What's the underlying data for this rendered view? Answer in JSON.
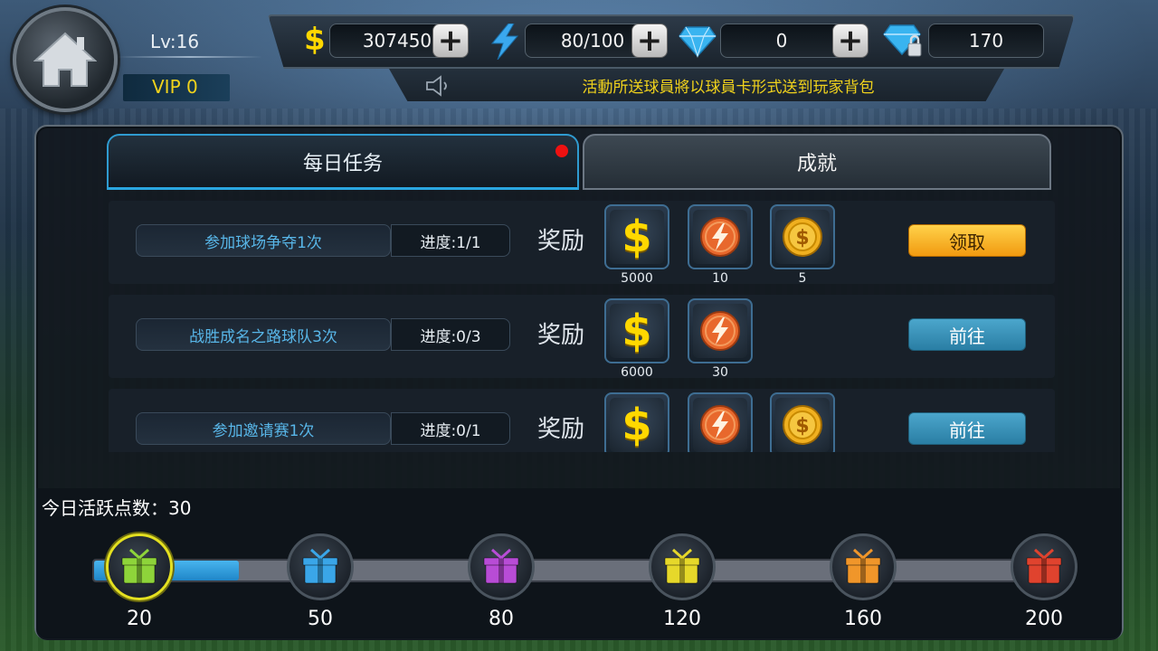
{
  "header": {
    "level": "Lv:16",
    "vip": "VIP 0"
  },
  "resources": {
    "money": {
      "icon": "dollar-icon",
      "value": "307450"
    },
    "energy": {
      "icon": "lightning-icon",
      "value": "80/100"
    },
    "diamond": {
      "icon": "diamond-icon",
      "value": "0"
    },
    "locked_diamond": {
      "icon": "locked-diamond-icon",
      "value": "170"
    }
  },
  "notice": {
    "text": "活動所送球員將以球員卡形式送到玩家背包"
  },
  "tabs": {
    "daily": "每日任务",
    "achievement": "成就"
  },
  "tasks": [
    {
      "title": "参加球场争夺1次",
      "progress": "进度:1/1",
      "reward_label": "奖励",
      "rewards": [
        {
          "type": "dollar",
          "count": "5000"
        },
        {
          "type": "energy",
          "count": "10"
        },
        {
          "type": "coin",
          "count": "5"
        }
      ],
      "button": "领取"
    },
    {
      "title": "战胜成名之路球队3次",
      "progress": "进度:0/3",
      "reward_label": "奖励",
      "rewards": [
        {
          "type": "dollar",
          "count": "6000"
        },
        {
          "type": "energy",
          "count": "30"
        }
      ],
      "button": "前往"
    },
    {
      "title": "参加邀请赛1次",
      "progress": "进度:0/1",
      "reward_label": "奖励",
      "rewards": [
        {
          "type": "dollar",
          "count": ""
        },
        {
          "type": "energy",
          "count": ""
        },
        {
          "type": "coin",
          "count": ""
        }
      ],
      "button": "前往"
    }
  ],
  "activity": {
    "label": "今日活跃点数：30",
    "current_points": 30,
    "milestones": [
      {
        "value": "20",
        "color": "#8ed43a"
      },
      {
        "value": "50",
        "color": "#3aa6e8"
      },
      {
        "value": "80",
        "color": "#b84cd6"
      },
      {
        "value": "120",
        "color": "#e6d82a"
      },
      {
        "value": "160",
        "color": "#f0962a"
      },
      {
        "value": "200",
        "color": "#e0432e"
      }
    ]
  }
}
